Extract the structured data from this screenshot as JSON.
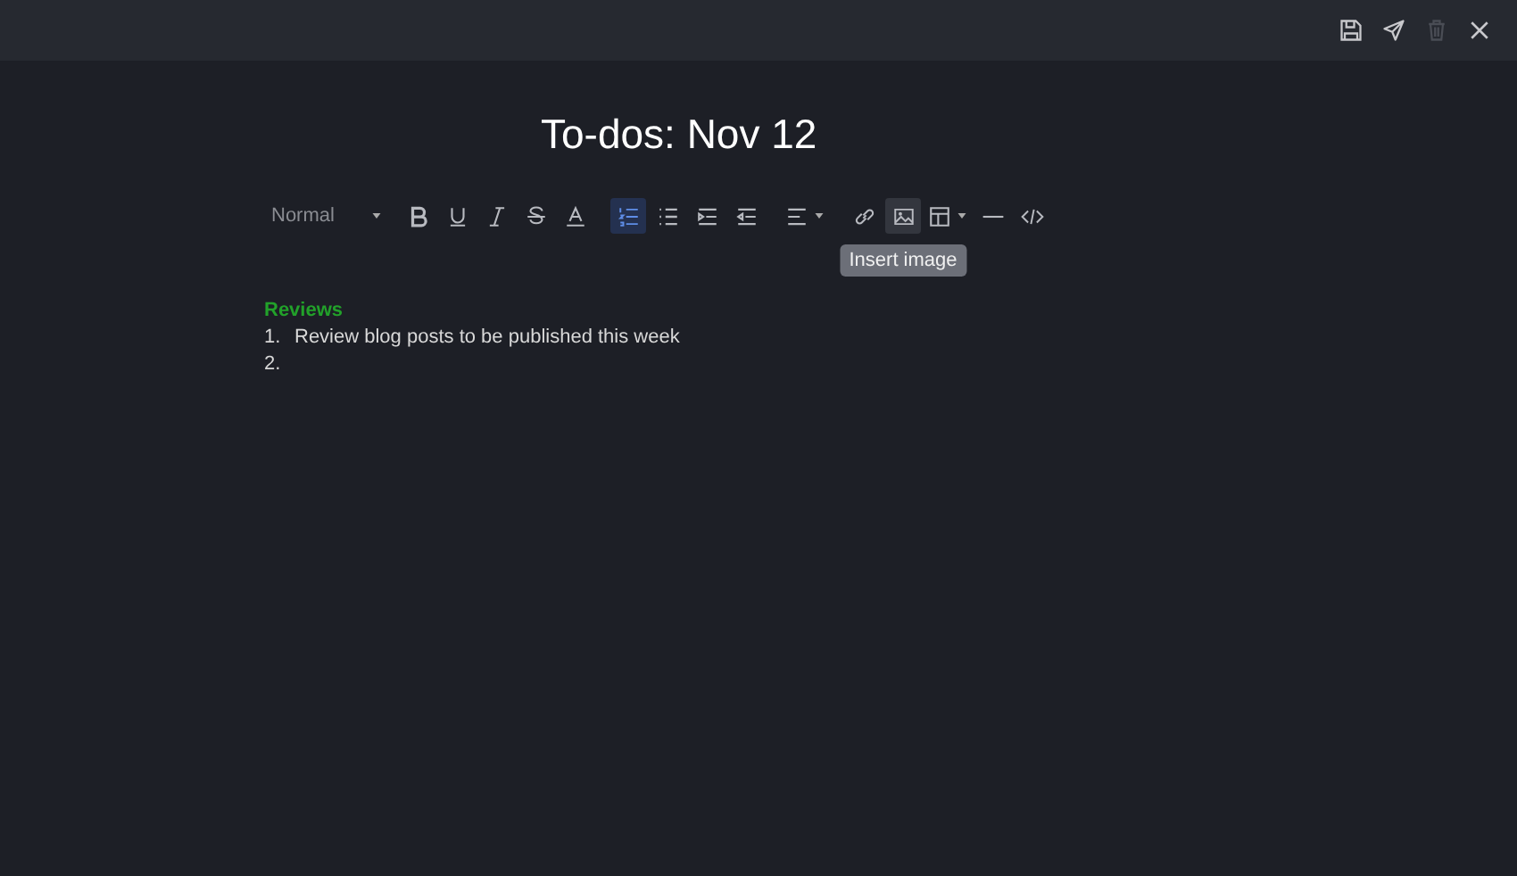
{
  "header_actions": [
    {
      "kind": "save",
      "disabled": false
    },
    {
      "kind": "send",
      "disabled": false
    },
    {
      "kind": "trash",
      "disabled": true
    },
    {
      "kind": "close",
      "disabled": false
    }
  ],
  "title": "To-dos: Nov 12",
  "toolbar": {
    "style_select": "Normal",
    "tools": [
      {
        "kind": "bold",
        "selected": false,
        "hovered": false
      },
      {
        "kind": "underline",
        "selected": false,
        "hovered": false
      },
      {
        "kind": "italic",
        "selected": false,
        "hovered": false
      },
      {
        "kind": "strike",
        "selected": false,
        "hovered": false
      },
      {
        "kind": "color",
        "selected": false,
        "hovered": false
      },
      {
        "kind": "ordered",
        "selected": true,
        "hovered": false
      },
      {
        "kind": "bullet",
        "selected": false,
        "hovered": false
      },
      {
        "kind": "indent",
        "selected": false,
        "hovered": false
      },
      {
        "kind": "outdent",
        "selected": false,
        "hovered": false
      },
      {
        "kind": "align",
        "selected": false,
        "hovered": false
      },
      {
        "kind": "link",
        "selected": false,
        "hovered": false
      },
      {
        "kind": "image",
        "selected": false,
        "hovered": true
      },
      {
        "kind": "table",
        "selected": false,
        "hovered": false
      },
      {
        "kind": "rule",
        "selected": false,
        "hovered": false
      },
      {
        "kind": "code",
        "selected": false,
        "hovered": false
      }
    ],
    "tooltip": "Insert image"
  },
  "body": {
    "heading": {
      "text": "Reviews",
      "color": "#22a12a"
    },
    "list": [
      {
        "number": "1.",
        "text": "Review blog posts to be published this week"
      },
      {
        "number": "2."
      }
    ]
  }
}
